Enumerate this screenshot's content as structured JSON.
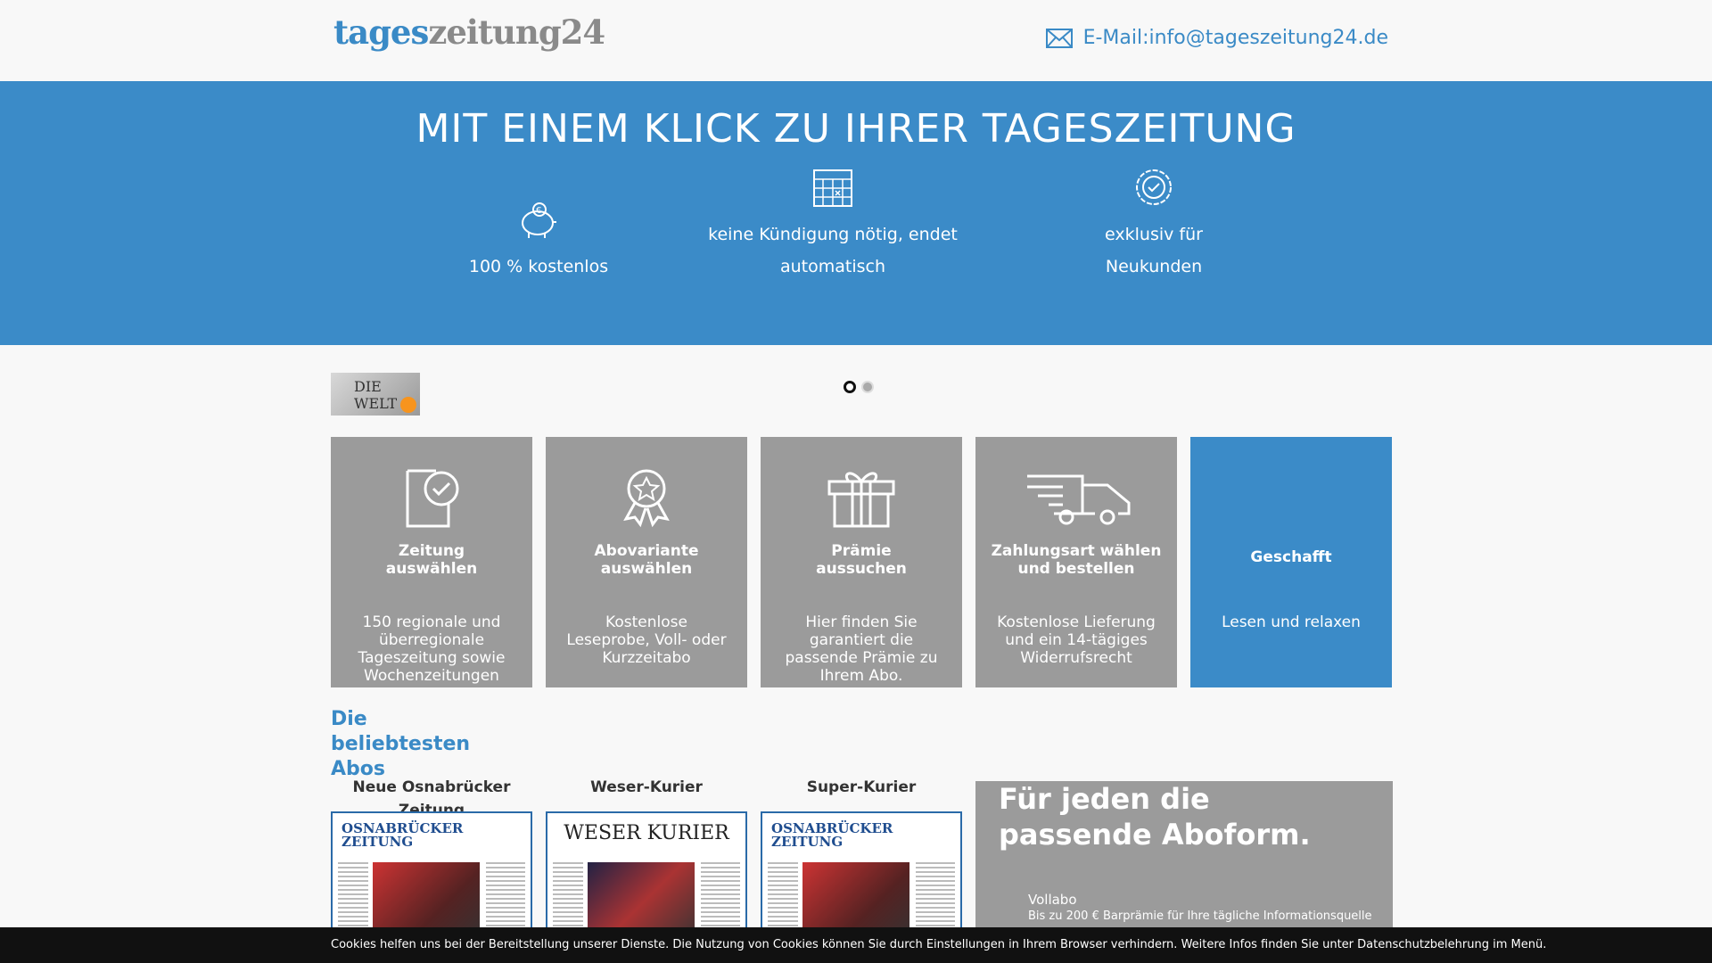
{
  "header": {
    "logo_part1": "tages",
    "logo_part2": "zeitung24",
    "email_label": "E-Mail:info@tageszeitung24.de"
  },
  "hero": {
    "title": "MIT EINEM KLICK ZU IHRER TAGESZEITUNG",
    "features": [
      {
        "icon": "piggy-bank-icon",
        "text": "100 % kostenlos"
      },
      {
        "icon": "calendar-icon",
        "line1": "keine Kündigung nötig, endet",
        "line2": "automatisch"
      },
      {
        "icon": "badge-check-icon",
        "line1": "exklusiv für",
        "line2": "Neukunden"
      }
    ]
  },
  "banner": {
    "thumb_text": "DIE WELT",
    "dots": 2,
    "active_dot": 1
  },
  "steps": [
    {
      "icon": "document-check-icon",
      "title_line1": "Zeitung",
      "title_line2": "auswählen",
      "desc": "150 regionale und überregionale Tageszeitung sowie Wochenzeitungen"
    },
    {
      "icon": "award-ribbon-icon",
      "title_line1": "Abovariante",
      "title_line2": "auswählen",
      "desc": "Kostenlose Leseprobe, Voll- oder Kurzzeitabo"
    },
    {
      "icon": "gift-icon",
      "title_line1": "Prämie",
      "title_line2": "aussuchen",
      "desc": "Hier finden Sie garantiert die passende Prämie zu Ihrem Abo."
    },
    {
      "icon": "delivery-truck-icon",
      "title_line1": "Zahlungsart wählen",
      "title_line2": "und bestellen",
      "desc": "Kostenlose Lieferung und ein 14-tägiges Widerrufsrecht"
    },
    {
      "title_line1": "Geschafft",
      "desc": "Lesen und relaxen"
    }
  ],
  "popular": {
    "heading_line1": "Die beliebtesten",
    "heading_line2": "Abos",
    "papers": [
      {
        "name": "Neue Osnabrücker Zeitung",
        "mast": "OSNABRÜCKER ZEITUNG"
      },
      {
        "name": "Weser-Kurier",
        "mast": "WESER KURIER"
      },
      {
        "name": "Super-Kurier",
        "mast": "OSNABRÜCKER ZEITUNG"
      }
    ]
  },
  "aboform": {
    "heading": "Für jeden die passende Aboform.",
    "option": "Vollabo",
    "option_desc": "Bis zu 200 € Barprämie für Ihre tägliche Informationsquelle"
  },
  "cookie": {
    "text": "Cookies helfen uns bei der Bereitstellung unserer Dienste. Die Nutzung von Cookies können Sie durch Einstellungen in Ihrem Browser verhindern. Weitere Infos finden Sie unter Datenschutzbelehrung im Menü."
  },
  "colors": {
    "brand_blue": "#3b8bc8",
    "step_gray": "#9b9b9b",
    "cookie_bg": "#111111"
  }
}
